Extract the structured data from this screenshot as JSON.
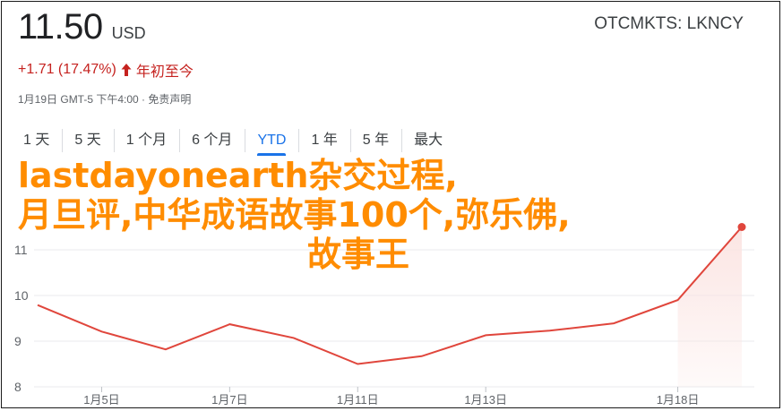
{
  "quote": {
    "price": "11.50",
    "currency": "USD",
    "exchange": "OTCMKTS: LKNCY",
    "change": "+1.71 (17.47%)",
    "change_period": "年初至今",
    "meta": "1月19日 GMT-5 下午4:00 · 免责声明"
  },
  "tabs": [
    {
      "label": "1 天"
    },
    {
      "label": "5 天"
    },
    {
      "label": "1 个月"
    },
    {
      "label": "6 个月"
    },
    {
      "label": "YTD",
      "active": true
    },
    {
      "label": "1 年"
    },
    {
      "label": "5 年"
    },
    {
      "label": "最大"
    }
  ],
  "overlay": {
    "line1": "lastdayonearth杂交过程,",
    "line2": "月旦评,中华成语故事100个,弥乐佛,",
    "line3": "故事王"
  },
  "colors": {
    "line": "#e0463c",
    "fill": "#fbe5e3",
    "accent": "#1a73e8",
    "negative_change": "#c5221f",
    "overlay_text": "#ff8c00"
  },
  "chart_data": {
    "type": "line",
    "x": [
      "1月4日",
      "1月5日",
      "1月6日",
      "1月7日",
      "1月8日",
      "1月11日",
      "1月12日",
      "1月13日",
      "1月14日",
      "1月15日",
      "1月18日",
      "1月19日"
    ],
    "x_ticks": [
      "1月5日",
      "1月7日",
      "1月11日",
      "1月13日",
      "1月18日"
    ],
    "series": [
      {
        "values": [
          9.79,
          9.21,
          8.82,
          9.37,
          9.07,
          8.5,
          8.67,
          9.13,
          9.23,
          9.39,
          9.9,
          11.5
        ]
      }
    ],
    "y_ticks": [
      8,
      9,
      10,
      11
    ],
    "ylim": [
      8,
      12
    ],
    "last_point_marker": true,
    "grid": true,
    "area_fill": true
  }
}
